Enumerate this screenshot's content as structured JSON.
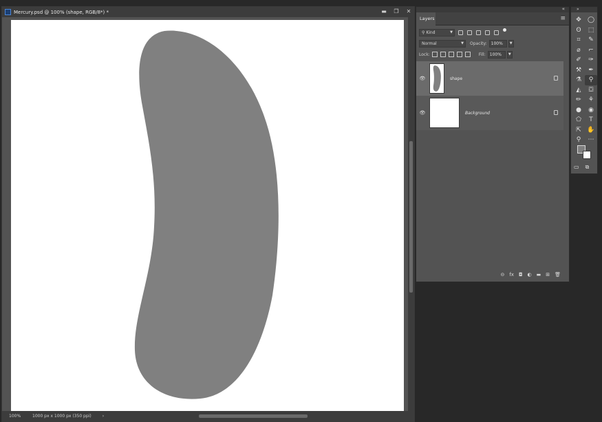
{
  "document": {
    "title": "Mercury.psd @ 100% (shape, RGB/8*) *",
    "zoom": "100%",
    "info": "1000 px x 1000 px (350 ppi)",
    "status_arrow": "›",
    "controls": {
      "minimize": "▬",
      "restore": "❐",
      "close": "✕"
    }
  },
  "layers_panel": {
    "tab": "Layers",
    "collapse": "«",
    "menu": "≡",
    "filter_kind": "Kind",
    "blend_mode": "Normal",
    "opacity_label": "Opacity:",
    "opacity_value": "100%",
    "lock_label": "Lock:",
    "fill_label": "Fill:",
    "fill_value": "100%",
    "layers": [
      {
        "name": "shape",
        "visible": true,
        "selected": true,
        "visibility_icon": "👁"
      },
      {
        "name": "Background",
        "visible": true,
        "selected": false,
        "visibility_icon": "👁"
      }
    ],
    "footer_icons": [
      "⊝",
      "fx",
      "◘",
      "◐",
      "▬",
      "⊞",
      "🗑"
    ]
  },
  "toolbar": {
    "collapse": "»",
    "tools": [
      "✥",
      "◯",
      "ʘ",
      "⬚",
      "⌗",
      "✎",
      "⌀",
      "⌐",
      "✐",
      "✑",
      "⚒",
      "✒",
      "⚗",
      "⚲",
      "◭",
      "⛋",
      "✏",
      "⚘",
      "●",
      "◉",
      "⬠",
      "T",
      "⇱",
      "✋",
      "⚲",
      "⋯"
    ],
    "foreground_color": "#808080",
    "background_color": "#ffffff",
    "mode_icons": [
      "▭",
      "⧉"
    ]
  },
  "colors": {
    "shape_fill": "#808080",
    "canvas": "#ffffff",
    "workspace": "#535353"
  }
}
